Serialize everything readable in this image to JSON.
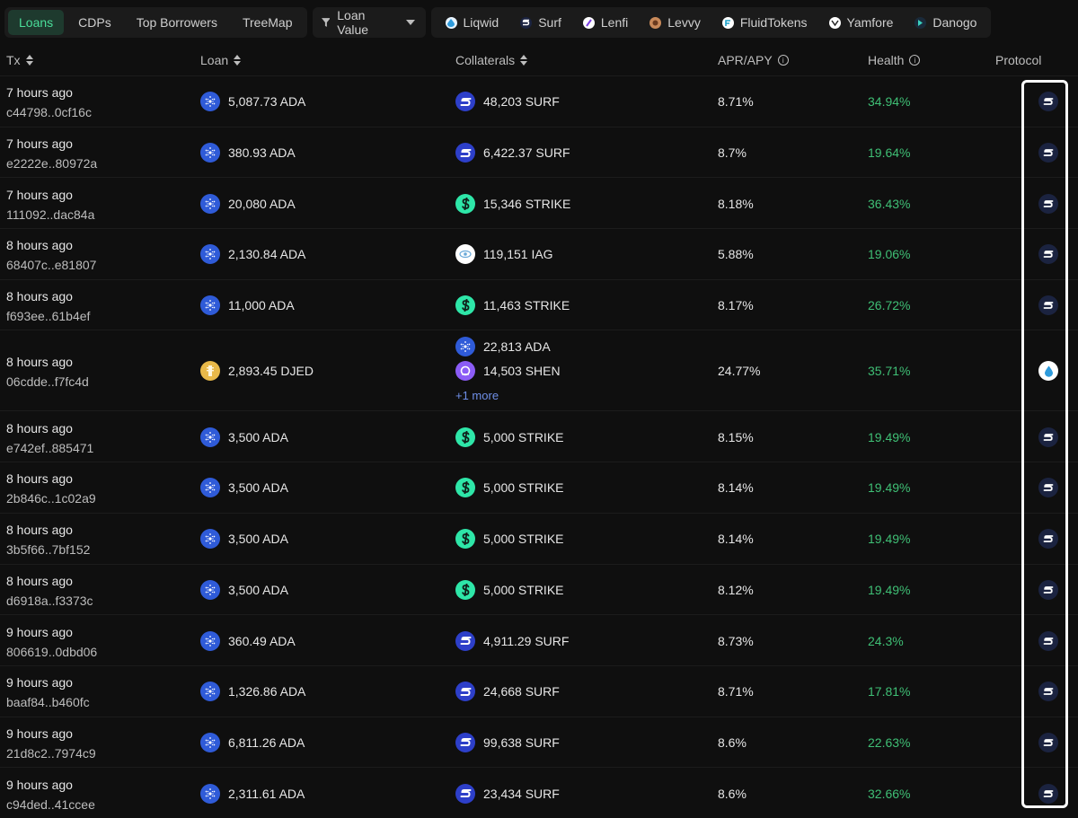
{
  "nav": {
    "tabs": [
      {
        "label": "Loans",
        "active": true
      },
      {
        "label": "CDPs",
        "active": false
      },
      {
        "label": "Top Borrowers",
        "active": false
      },
      {
        "label": "TreeMap",
        "active": false
      }
    ],
    "filter_label": "Loan Value",
    "protocols": [
      {
        "label": "Liqwid",
        "icon": "droplet-icon",
        "color": "#e8f4ff"
      },
      {
        "label": "Surf",
        "icon": "surf-icon",
        "color": "#1b2340"
      },
      {
        "label": "Lenfi",
        "icon": "lenfi-icon",
        "color": "#ffffff"
      },
      {
        "label": "Levvy",
        "icon": "levvy-icon",
        "color": "#c98a5a"
      },
      {
        "label": "FluidTokens",
        "icon": "fluidtokens-icon",
        "color": "#ffffff"
      },
      {
        "label": "Yamfore",
        "icon": "yamfore-icon",
        "color": "#ffffff"
      },
      {
        "label": "Danogo",
        "icon": "danogo-icon",
        "color": "#1a2a3a"
      }
    ]
  },
  "columns": {
    "tx": "Tx",
    "loan": "Loan",
    "collaterals": "Collaterals",
    "apr": "APR/APY",
    "health": "Health",
    "protocol": "Protocol"
  },
  "colors": {
    "accent_green": "#4ade9a",
    "health_green": "#3fbf75",
    "ada_blue": "#2f5bd8",
    "surf_blue": "#2d3fc9",
    "strike_green": "#2ee6a8",
    "more_link": "#6f8fe8"
  },
  "rows": [
    {
      "time": "7 hours ago",
      "hash": "c44798..0cf16c",
      "loan": "5,087.73 ADA",
      "loan_icon": "ada-icon",
      "collaterals": [
        {
          "text": "48,203 SURF",
          "icon": "surf-icon"
        }
      ],
      "more": "",
      "apr": "8.71%",
      "health": "34.94%",
      "protocol": "surf-icon"
    },
    {
      "time": "7 hours ago",
      "hash": "e2222e..80972a",
      "loan": "380.93 ADA",
      "loan_icon": "ada-icon",
      "collaterals": [
        {
          "text": "6,422.37 SURF",
          "icon": "surf-icon"
        }
      ],
      "more": "",
      "apr": "8.7%",
      "health": "19.64%",
      "protocol": "surf-icon"
    },
    {
      "time": "7 hours ago",
      "hash": "111092..dac84a",
      "loan": "20,080 ADA",
      "loan_icon": "ada-icon",
      "collaterals": [
        {
          "text": "15,346 STRIKE",
          "icon": "strike-icon"
        }
      ],
      "more": "",
      "apr": "8.18%",
      "health": "36.43%",
      "protocol": "surf-icon"
    },
    {
      "time": "8 hours ago",
      "hash": "68407c..e81807",
      "loan": "2,130.84 ADA",
      "loan_icon": "ada-icon",
      "collaterals": [
        {
          "text": "119,151 IAG",
          "icon": "iag-icon"
        }
      ],
      "more": "",
      "apr": "5.88%",
      "health": "19.06%",
      "protocol": "surf-icon"
    },
    {
      "time": "8 hours ago",
      "hash": "f693ee..61b4ef",
      "loan": "11,000 ADA",
      "loan_icon": "ada-icon",
      "collaterals": [
        {
          "text": "11,463 STRIKE",
          "icon": "strike-icon"
        }
      ],
      "more": "",
      "apr": "8.17%",
      "health": "26.72%",
      "protocol": "surf-icon"
    },
    {
      "time": "8 hours ago",
      "hash": "06cdde..f7fc4d",
      "loan": "2,893.45 DJED",
      "loan_icon": "djed-icon",
      "collaterals": [
        {
          "text": "22,813 ADA",
          "icon": "ada-icon"
        },
        {
          "text": "14,503 SHEN",
          "icon": "shen-icon"
        }
      ],
      "more": "+1 more",
      "apr": "24.77%",
      "health": "35.71%",
      "protocol": "droplet-icon"
    },
    {
      "time": "8 hours ago",
      "hash": "e742ef..885471",
      "loan": "3,500 ADA",
      "loan_icon": "ada-icon",
      "collaterals": [
        {
          "text": "5,000 STRIKE",
          "icon": "strike-icon"
        }
      ],
      "more": "",
      "apr": "8.15%",
      "health": "19.49%",
      "protocol": "surf-icon"
    },
    {
      "time": "8 hours ago",
      "hash": "2b846c..1c02a9",
      "loan": "3,500 ADA",
      "loan_icon": "ada-icon",
      "collaterals": [
        {
          "text": "5,000 STRIKE",
          "icon": "strike-icon"
        }
      ],
      "more": "",
      "apr": "8.14%",
      "health": "19.49%",
      "protocol": "surf-icon"
    },
    {
      "time": "8 hours ago",
      "hash": "3b5f66..7bf152",
      "loan": "3,500 ADA",
      "loan_icon": "ada-icon",
      "collaterals": [
        {
          "text": "5,000 STRIKE",
          "icon": "strike-icon"
        }
      ],
      "more": "",
      "apr": "8.14%",
      "health": "19.49%",
      "protocol": "surf-icon"
    },
    {
      "time": "8 hours ago",
      "hash": "d6918a..f3373c",
      "loan": "3,500 ADA",
      "loan_icon": "ada-icon",
      "collaterals": [
        {
          "text": "5,000 STRIKE",
          "icon": "strike-icon"
        }
      ],
      "more": "",
      "apr": "8.12%",
      "health": "19.49%",
      "protocol": "surf-icon"
    },
    {
      "time": "9 hours ago",
      "hash": "806619..0dbd06",
      "loan": "360.49 ADA",
      "loan_icon": "ada-icon",
      "collaterals": [
        {
          "text": "4,911.29 SURF",
          "icon": "surf-icon"
        }
      ],
      "more": "",
      "apr": "8.73%",
      "health": "24.3%",
      "protocol": "surf-icon"
    },
    {
      "time": "9 hours ago",
      "hash": "baaf84..b460fc",
      "loan": "1,326.86 ADA",
      "loan_icon": "ada-icon",
      "collaterals": [
        {
          "text": "24,668 SURF",
          "icon": "surf-icon"
        }
      ],
      "more": "",
      "apr": "8.71%",
      "health": "17.81%",
      "protocol": "surf-icon"
    },
    {
      "time": "9 hours ago",
      "hash": "21d8c2..7974c9",
      "loan": "6,811.26 ADA",
      "loan_icon": "ada-icon",
      "collaterals": [
        {
          "text": "99,638 SURF",
          "icon": "surf-icon"
        }
      ],
      "more": "",
      "apr": "8.6%",
      "health": "22.63%",
      "protocol": "surf-icon"
    },
    {
      "time": "9 hours ago",
      "hash": "c94ded..41ccee",
      "loan": "2,311.61 ADA",
      "loan_icon": "ada-icon",
      "collaterals": [
        {
          "text": "23,434 SURF",
          "icon": "surf-icon"
        }
      ],
      "more": "",
      "apr": "8.6%",
      "health": "32.66%",
      "protocol": "surf-icon"
    }
  ]
}
